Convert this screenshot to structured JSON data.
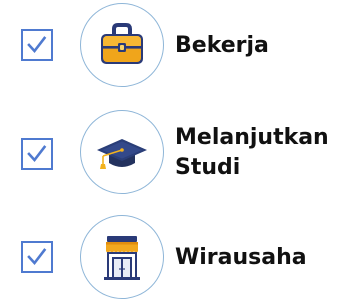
{
  "colors": {
    "checkbox_border": "#4f7ad0",
    "check_mark": "#4f7ad0",
    "badge_border": "#8fb6d8",
    "text": "#111111"
  },
  "options": [
    {
      "label_lines": [
        "Bekerja"
      ],
      "icon": "briefcase-icon",
      "checked": true
    },
    {
      "label_lines": [
        "Melanjutkan",
        "Studi"
      ],
      "icon": "graduation-cap-icon",
      "checked": true
    },
    {
      "label_lines": [
        "Wirausaha"
      ],
      "icon": "storefront-icon",
      "checked": true
    }
  ]
}
